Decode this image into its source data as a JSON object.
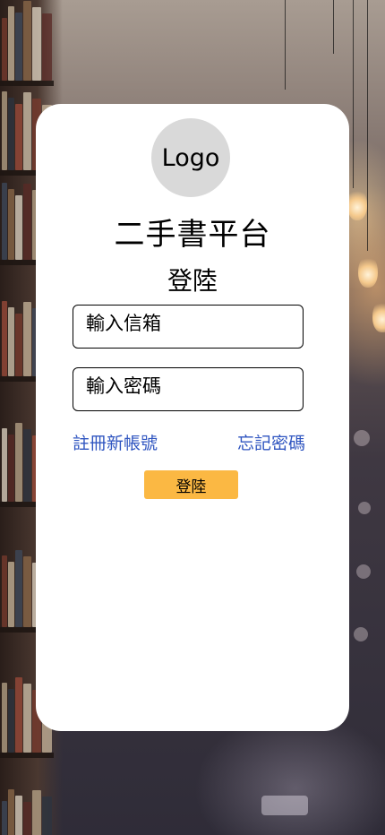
{
  "background": {
    "description_icon": "library-bookshelf-background"
  },
  "card": {
    "logo_text": "Logo",
    "app_title": "二手書平台",
    "heading": "登陸",
    "email_placeholder": "輸入信箱",
    "password_placeholder": "輸入密碼",
    "register_link": "註冊新帳號",
    "forgot_link": "忘記密碼",
    "login_button": "登陸"
  },
  "colors": {
    "card_bg": "#ffffff",
    "logo_bg": "#d9d9d9",
    "link": "#2f55c0",
    "button": "#fbb843"
  }
}
